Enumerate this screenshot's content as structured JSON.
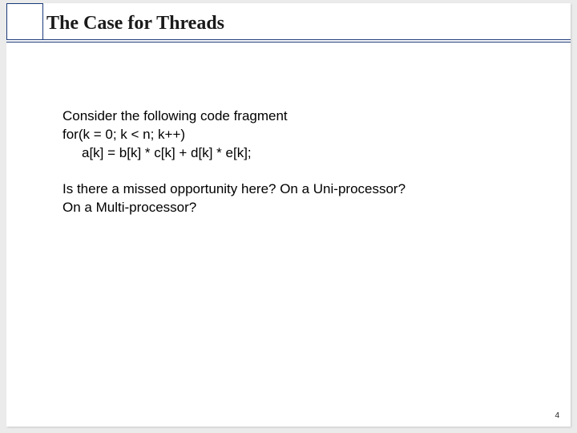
{
  "slide": {
    "title": "The Case for Threads",
    "body": {
      "p1": "Consider the following code fragment",
      "p2": "for(k = 0; k < n; k++)",
      "p3": "a[k] = b[k] * c[k] + d[k] * e[k];",
      "p4": "Is there a missed opportunity here? On a Uni-processor?",
      "p5": "On a Multi-processor?"
    },
    "page_number": "4"
  }
}
